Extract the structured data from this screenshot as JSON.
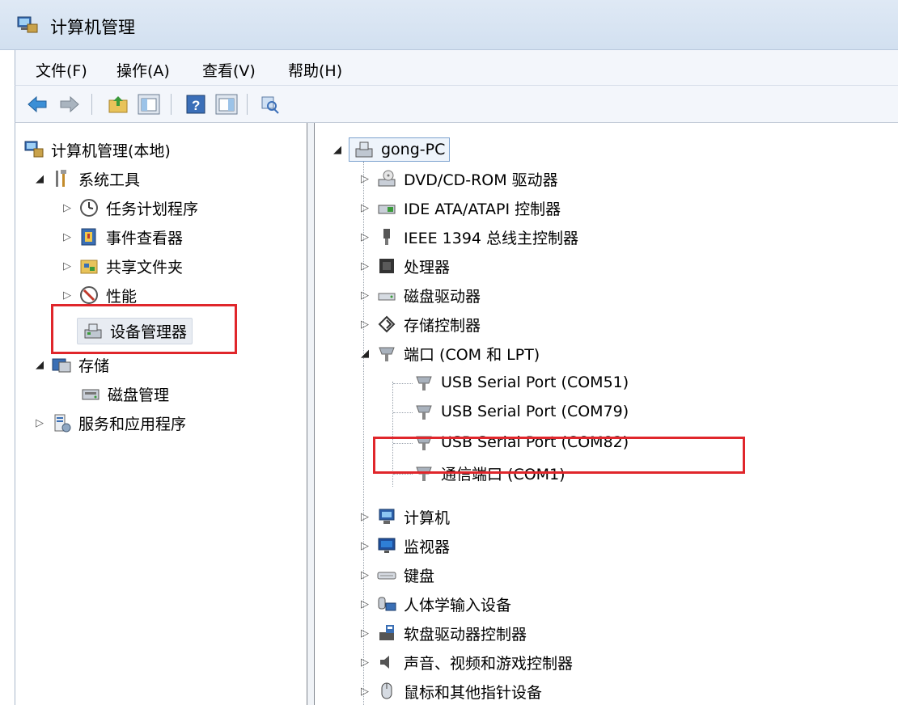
{
  "window": {
    "title": "计算机管理"
  },
  "menu": [
    "文件(F)",
    "操作(A)",
    "查看(V)",
    "帮助(H)"
  ],
  "toolbar": {
    "icons": [
      "back-arrow-icon",
      "forward-arrow-icon",
      "up-folder-icon",
      "show-hide-tree-icon",
      "help-icon",
      "action-pane-icon",
      "properties-icon"
    ]
  },
  "left_tree": {
    "root": "计算机管理(本地)",
    "system_tools": "系统工具",
    "task_scheduler": "任务计划程序",
    "event_viewer": "事件查看器",
    "shared_folders": "共享文件夹",
    "performance": "性能",
    "device_manager": "设备管理器",
    "storage": "存储",
    "disk_management": "磁盘管理",
    "services_apps": "服务和应用程序"
  },
  "device_tree": {
    "root": "gong-PC",
    "categories": [
      "DVD/CD-ROM 驱动器",
      "IDE ATA/ATAPI 控制器",
      "IEEE 1394 总线主控制器",
      "处理器",
      "磁盘驱动器",
      "存储控制器",
      "端口 (COM 和 LPT)",
      "计算机",
      "监视器",
      "键盘",
      "人体学输入设备",
      "软盘驱动器控制器",
      "声音、视频和游戏控制器",
      "鼠标和其他指针设备"
    ],
    "ports": [
      "USB Serial Port (COM51)",
      "USB Serial Port (COM79)",
      "USB Serial Port (COM82)",
      "通信端口 (COM1)"
    ]
  },
  "colors": {
    "highlight_box": "#e0262b",
    "titlebar": "#d9e5f3"
  }
}
